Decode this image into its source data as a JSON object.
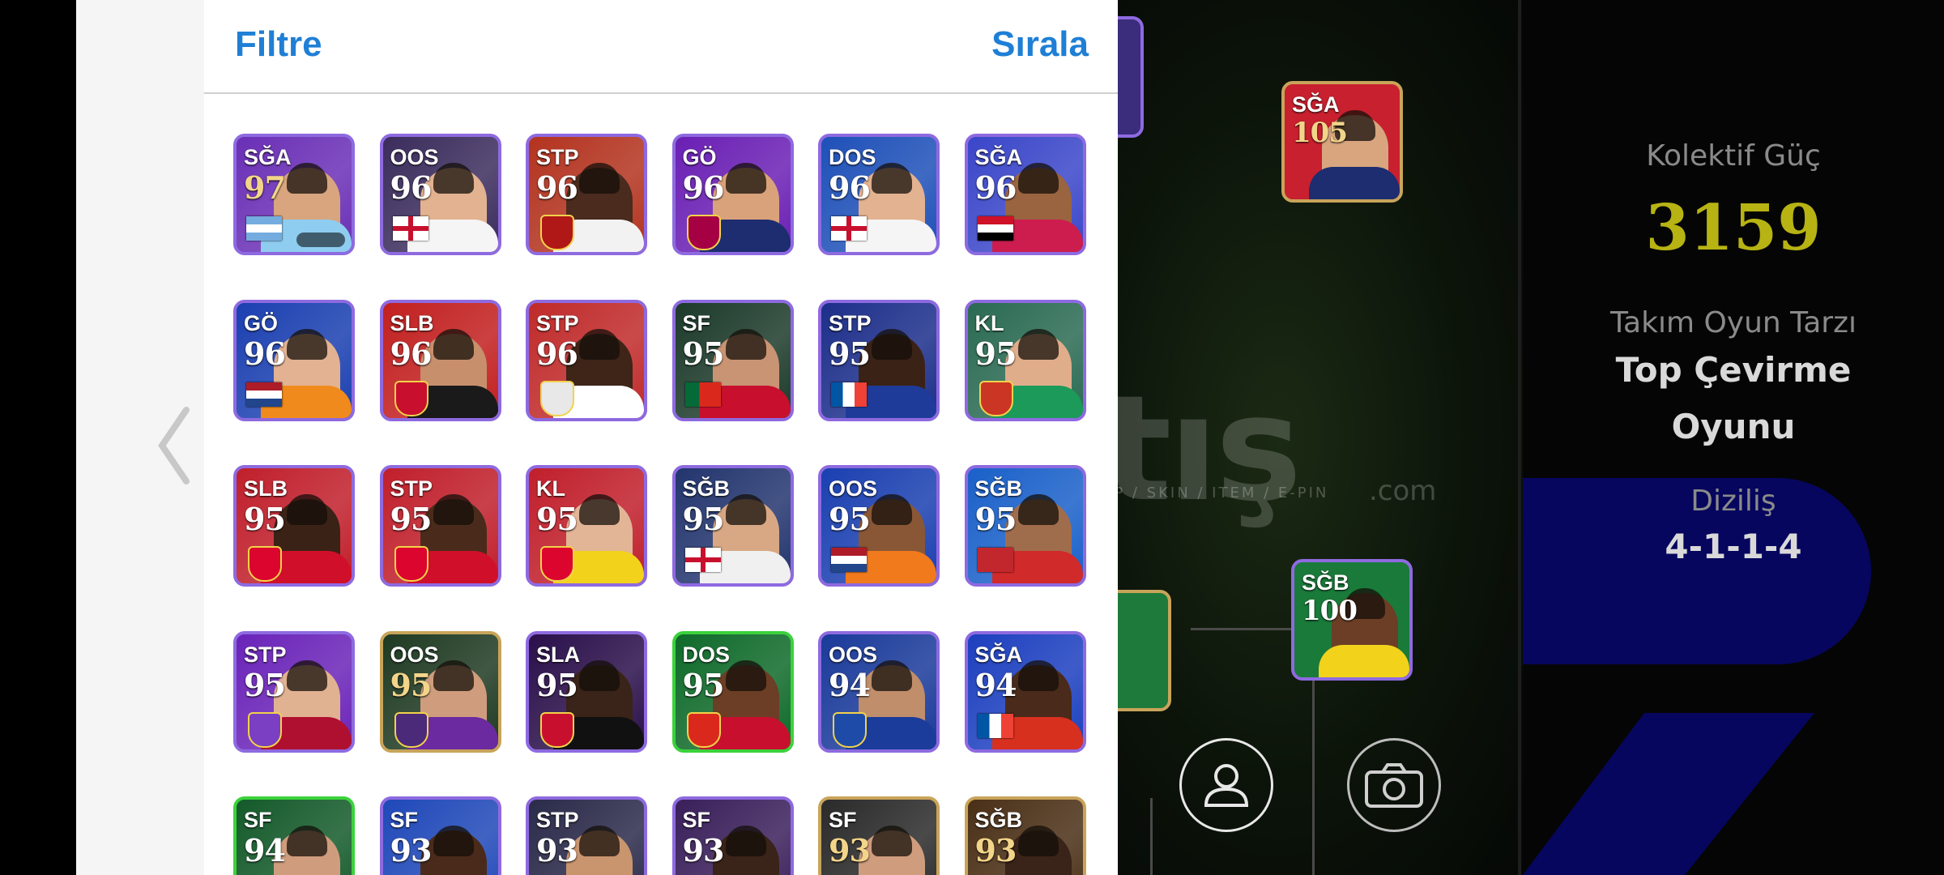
{
  "panel": {
    "filter_label": "Filtre",
    "sort_label": "Sırala"
  },
  "players": [
    {
      "pos": "SĞA",
      "rating": "97",
      "flag": "argentina",
      "bg": "#6a2fb6",
      "skin": "#d8a57f",
      "shirt": "#8ecdf0",
      "border": "#8e6ae0",
      "gold": true
    },
    {
      "pos": "OOS",
      "rating": "96",
      "flag": "england",
      "bg": "#3b2c5c",
      "skin": "#e3b291",
      "shirt": "#f5f5f5",
      "border": "#8e6ae0"
    },
    {
      "pos": "STP",
      "rating": "96",
      "flag": "club-red",
      "bg": "#b3331f",
      "skin": "#4a2b1d",
      "shirt": "#f2f2f2",
      "border": "#8e6ae0"
    },
    {
      "pos": "GÖ",
      "rating": "96",
      "flag": "club-barca",
      "bg": "#6a1fb4",
      "skin": "#d9a27a",
      "shirt": "#1d2d70",
      "border": "#8e6ae0"
    },
    {
      "pos": "DOS",
      "rating": "96",
      "flag": "england",
      "bg": "#1e50b8",
      "skin": "#e3b291",
      "shirt": "#f5f5f5",
      "border": "#8e6ae0"
    },
    {
      "pos": "SĞA",
      "rating": "96",
      "flag": "egypt",
      "bg": "#3a46c9",
      "skin": "#9a6440",
      "shirt": "#cc1d4e",
      "border": "#8e6ae0"
    },
    {
      "pos": "GÖ",
      "rating": "96",
      "flag": "netherlands",
      "bg": "#1a3fb0",
      "skin": "#e2b293",
      "shirt": "#f08a1c",
      "border": "#8e6ae0"
    },
    {
      "pos": "SLB",
      "rating": "96",
      "flag": "club-milan",
      "bg": "#c21f1f",
      "skin": "#c88f6c",
      "shirt": "#1a1a1a",
      "border": "#8e6ae0"
    },
    {
      "pos": "STP",
      "rating": "96",
      "flag": "club-white",
      "bg": "#c02a2a",
      "skin": "#3f2418",
      "shirt": "#ffffff",
      "border": "#8e6ae0"
    },
    {
      "pos": "SF",
      "rating": "95",
      "flag": "portugal",
      "bg": "#1c3a2a",
      "skin": "#c99473",
      "shirt": "#c8102e",
      "border": "#8e6ae0"
    },
    {
      "pos": "STP",
      "rating": "95",
      "flag": "france",
      "bg": "#1c2e8a",
      "skin": "#3b2217",
      "shirt": "#1f3b9a",
      "border": "#8e6ae0"
    },
    {
      "pos": "KL",
      "rating": "95",
      "flag": "club-atm",
      "bg": "#2a6a52",
      "skin": "#e0ad8b",
      "shirt": "#1c9a5a",
      "border": "#8e6ae0"
    },
    {
      "pos": "SLB",
      "rating": "95",
      "flag": "club-bayern",
      "bg": "#c01f2b",
      "skin": "#3b2216",
      "shirt": "#d0102a",
      "border": "#8e6ae0"
    },
    {
      "pos": "STP",
      "rating": "95",
      "flag": "club-bayern",
      "bg": "#c01f2b",
      "skin": "#4a2b1b",
      "shirt": "#d0102a",
      "border": "#8e6ae0"
    },
    {
      "pos": "KL",
      "rating": "95",
      "flag": "club-bayern",
      "bg": "#c01f2b",
      "skin": "#e2b596",
      "shirt": "#f3d21c",
      "border": "#8e6ae0"
    },
    {
      "pos": "SĞB",
      "rating": "95",
      "flag": "england",
      "bg": "#23356e",
      "skin": "#d8a884",
      "shirt": "#f0f0f0",
      "border": "#8e6ae0"
    },
    {
      "pos": "OOS",
      "rating": "95",
      "flag": "netherlands",
      "bg": "#1a3fb0",
      "skin": "#8a5736",
      "shirt": "#f07a1c",
      "border": "#8e6ae0"
    },
    {
      "pos": "SĞB",
      "rating": "95",
      "flag": "morocco",
      "bg": "#1a60c9",
      "skin": "#a06d4c",
      "shirt": "#d02a2a",
      "border": "#8e6ae0"
    },
    {
      "pos": "STP",
      "rating": "95",
      "flag": "club-purple",
      "bg": "#6a23b8",
      "skin": "#e1b292",
      "shirt": "#b01030",
      "border": "#8e6ae0"
    },
    {
      "pos": "OOS",
      "rating": "95",
      "flag": "club-fio",
      "bg": "#1f3a22",
      "skin": "#cf9d7d",
      "shirt": "#6b2aa0",
      "border": "#c8a45a",
      "gold": true
    },
    {
      "pos": "SLA",
      "rating": "95",
      "flag": "club-milan",
      "bg": "#2a0f4a",
      "skin": "#3a2318",
      "shirt": "#111111",
      "border": "#8e6ae0"
    },
    {
      "pos": "DOS",
      "rating": "95",
      "flag": "club-manutd",
      "bg": "#0f6a2a",
      "skin": "#6b3e25",
      "shirt": "#c8102e",
      "border": "#3bd23b"
    },
    {
      "pos": "OOS",
      "rating": "94",
      "flag": "club-bahia",
      "bg": "#1a3a9a",
      "skin": "#c08e6b",
      "shirt": "#1b3c9a",
      "border": "#8e6ae0"
    },
    {
      "pos": "SĞA",
      "rating": "94",
      "flag": "france",
      "bg": "#1c3fbf",
      "skin": "#4a2b1b",
      "shirt": "#d8301f",
      "border": "#8e6ae0"
    },
    {
      "pos": "SF",
      "rating": "94",
      "flag": "club-green",
      "bg": "#145a2a",
      "skin": "#cf9d7d",
      "shirt": "#f3d21c",
      "border": "#3bd23b"
    },
    {
      "pos": "SF",
      "rating": "93",
      "flag": "club-brazil",
      "bg": "#1f48b8",
      "skin": "#4a2b1b",
      "shirt": "#f3d21c",
      "border": "#8e6ae0"
    },
    {
      "pos": "STP",
      "rating": "93",
      "flag": "club-dark",
      "bg": "#2a2a4a",
      "skin": "#c9956f",
      "shirt": "#1a1a1a",
      "border": "#8e6ae0"
    },
    {
      "pos": "SF",
      "rating": "93",
      "flag": "club-dark",
      "bg": "#3a1f5a",
      "skin": "#3a2318",
      "shirt": "#f0f0f0",
      "border": "#8e6ae0"
    },
    {
      "pos": "SF",
      "rating": "93",
      "flag": "club-dark",
      "bg": "#2a2a2a",
      "skin": "#cf9d7d",
      "shirt": "#1a1a1a",
      "border": "#c8a45a",
      "gold": true
    },
    {
      "pos": "SĞB",
      "rating": "93",
      "flag": "club-dark",
      "bg": "#4a2f16",
      "skin": "#3a2318",
      "shirt": "#c8102e",
      "border": "#c8a45a",
      "gold": true
    }
  ],
  "pitch_cards": [
    {
      "pos": "SĞA",
      "rating": "105",
      "bg": "#c8202e",
      "skin": "#d8a57f",
      "shirt": "#1d2d70",
      "border": "#c8a45a"
    },
    {
      "pos": "SĞB",
      "rating": "100",
      "bg": "#1a7a3a",
      "skin": "#6b3e25",
      "shirt": "#f3d21c",
      "border": "#8e6ae0"
    }
  ],
  "info": {
    "kolektif_label": "Kolektif Güç",
    "kolektif_value": "3159",
    "style_label": "Takım Oyun Tarzı",
    "style_value_1": "Top Çevirme",
    "style_value_2": "Oyunu",
    "formation_label": "Diziliş",
    "formation_value": "4-1-1-4"
  },
  "watermark": {
    "main": "satış",
    "sub": "AP / SKIN / ITEM / E-PIN",
    "com": ".com"
  }
}
